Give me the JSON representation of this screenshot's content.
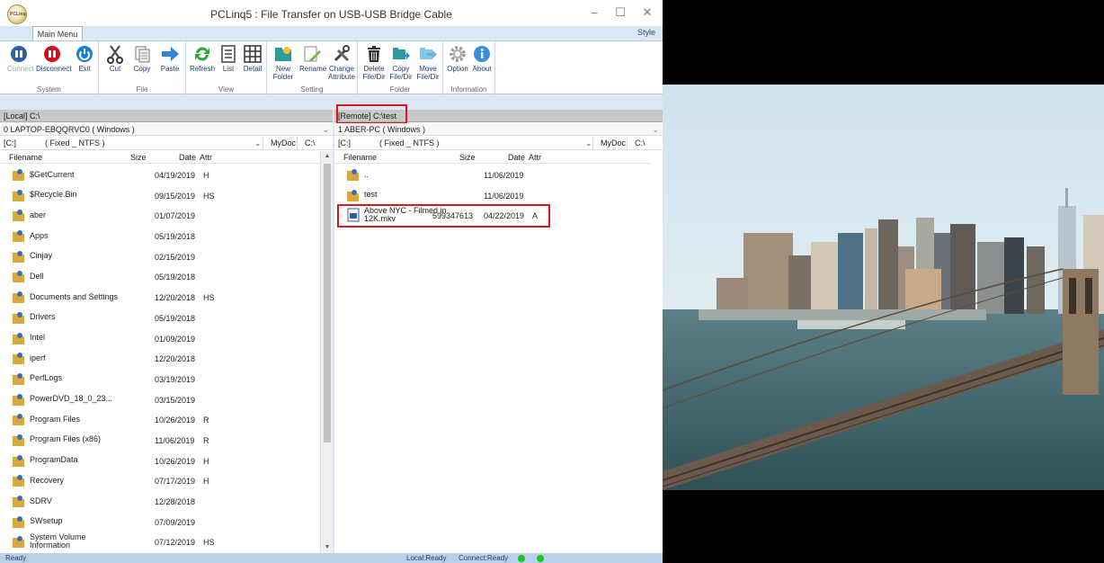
{
  "window": {
    "title": "PCLinq5 : File Transfer on USB-USB Bridge Cable",
    "logo_text": "PCLinq",
    "minimize": "–",
    "maximize": "☐",
    "close": "✕"
  },
  "ribbon": {
    "tab": "Main Menu",
    "style": "Style",
    "groups": {
      "system": "System",
      "file": "File",
      "view": "View",
      "setting": "Setting",
      "folder": "Folder",
      "information": "Information"
    },
    "buttons": {
      "connect": "Connect",
      "disconnect": "Disconnect",
      "exit": "Exit",
      "cut": "Cut",
      "copy": "Copy",
      "paste": "Paste",
      "refresh": "Refresh",
      "list": "List",
      "detail": "Detail",
      "new_folder_1": "New",
      "new_folder_2": "Folder",
      "rename": "Rename",
      "change_attr_1": "Change",
      "change_attr_2": "Attribute",
      "delete_1": "Delete",
      "delete_2": "File/Dir",
      "copy_fd_1": "Copy",
      "copy_fd_2": "File/Dir",
      "move_1": "Move",
      "move_2": "File/Dir",
      "option": "Option",
      "about": "About"
    }
  },
  "local": {
    "path": "[Local] C:\\",
    "machine": "0 LAPTOP-EBQQRVC0  ( Windows )",
    "drive": "[C:]",
    "fs": "( Fixed _ NTFS )",
    "mydoc": "MyDoc",
    "root": "C:\\",
    "headers": {
      "name": "Filename",
      "size": "Size",
      "date": "Date",
      "attr": "Attr"
    },
    "files": [
      {
        "name": "$GetCurrent",
        "size": "",
        "date": "04/19/2019",
        "attr": "H"
      },
      {
        "name": "$Recycle.Bin",
        "size": "",
        "date": "09/15/2019",
        "attr": "HS"
      },
      {
        "name": "aber",
        "size": "",
        "date": "01/07/2019",
        "attr": ""
      },
      {
        "name": "Apps",
        "size": "",
        "date": "05/19/2018",
        "attr": ""
      },
      {
        "name": "Cinjay",
        "size": "",
        "date": "02/15/2019",
        "attr": ""
      },
      {
        "name": "Dell",
        "size": "",
        "date": "05/19/2018",
        "attr": ""
      },
      {
        "name": "Documents and Settings",
        "size": "",
        "date": "12/20/2018",
        "attr": "HS"
      },
      {
        "name": "Drivers",
        "size": "",
        "date": "05/19/2018",
        "attr": ""
      },
      {
        "name": "Intel",
        "size": "",
        "date": "01/09/2019",
        "attr": ""
      },
      {
        "name": "iperf",
        "size": "",
        "date": "12/20/2018",
        "attr": ""
      },
      {
        "name": "PerfLogs",
        "size": "",
        "date": "03/19/2019",
        "attr": ""
      },
      {
        "name": "PowerDVD_18_0_23...",
        "size": "",
        "date": "03/15/2019",
        "attr": ""
      },
      {
        "name": "Program Files",
        "size": "",
        "date": "10/26/2019",
        "attr": "R"
      },
      {
        "name": "Program Files (x86)",
        "size": "",
        "date": "11/06/2019",
        "attr": "R"
      },
      {
        "name": "ProgramData",
        "size": "",
        "date": "10/26/2019",
        "attr": "H"
      },
      {
        "name": "Recovery",
        "size": "",
        "date": "07/17/2019",
        "attr": "H"
      },
      {
        "name": "SDRV",
        "size": "",
        "date": "12/28/2018",
        "attr": ""
      },
      {
        "name": "SWsetup",
        "size": "",
        "date": "07/09/2019",
        "attr": ""
      },
      {
        "name": "System Volume Information",
        "size": "",
        "date": "07/12/2019",
        "attr": "HS"
      }
    ]
  },
  "remote": {
    "path": "[Remote] C:\\test",
    "machine": "1 ABER-PC  ( Windows )",
    "drive": "[C:]",
    "fs": "( Fixed _ NTFS )",
    "mydoc": "MyDoc",
    "root": "C:\\",
    "headers": {
      "name": "Filename",
      "size": "Size",
      "date": "Date",
      "attr": "Attr"
    },
    "files": [
      {
        "name": "..",
        "size": "",
        "date": "11/06/2019",
        "attr": "",
        "type": "folder"
      },
      {
        "name": "test",
        "size": "",
        "date": "11/06/2019",
        "attr": "",
        "type": "folder"
      },
      {
        "name": "Above NYC - Filmed in 12K.mkv",
        "size": "599347613",
        "date": "04/22/2019",
        "attr": "A",
        "type": "video"
      }
    ]
  },
  "status": {
    "left": "Ready",
    "local": "Local:Ready",
    "connect": "Connect:Ready",
    "led_color": "#1cc51c"
  },
  "colors": {
    "highlight": "#e0141e",
    "ribbon_bg": "#dbe7f3",
    "statusbar": "#b9d0e8"
  }
}
